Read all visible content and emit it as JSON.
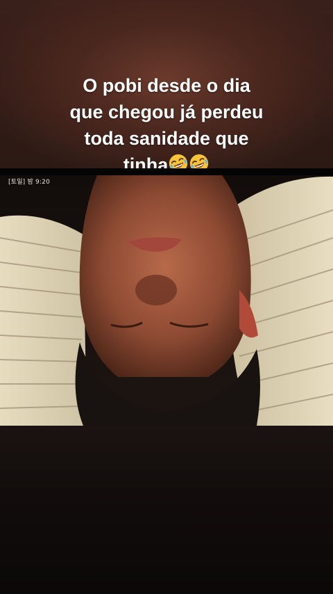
{
  "caption": {
    "line1": "O pobi desde o dia",
    "line2": "que chegou já perdeu",
    "line3": "toda sanidade que",
    "line4": "tinha"
  },
  "caption_emojis": [
    "rolling-on-floor-laughing-emoji",
    "rolling-on-floor-laughing-emoji"
  ],
  "video": {
    "timestamp": "[토일] 밤 9:20"
  }
}
